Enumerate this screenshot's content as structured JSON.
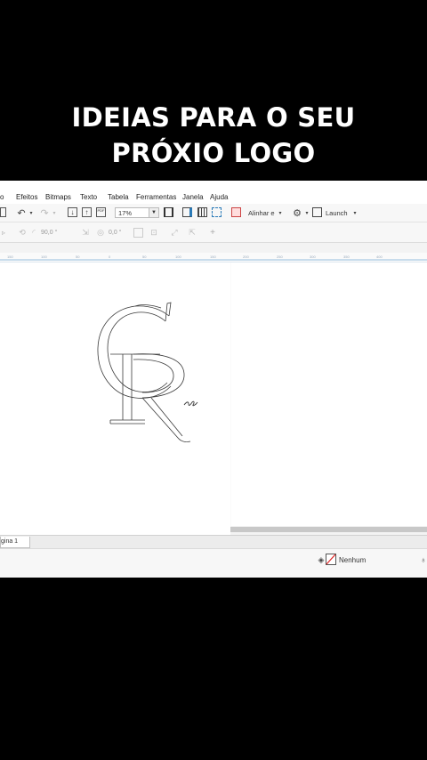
{
  "headline": {
    "line1": "IDEIAS PARA O SEU",
    "line2": "PRÓXIO LOGO"
  },
  "menu": [
    "o",
    "Efeitos",
    "Bitmaps",
    "Texto",
    "Tabela",
    "Ferramentas",
    "Janela",
    "Ajuda"
  ],
  "toolbar": {
    "zoom_value": "17%",
    "align_label": "Alinhar e",
    "launch_label": "Launch"
  },
  "property_bar": {
    "angle_value": "90,0 °",
    "rotation_value": "0,0 °"
  },
  "ruler_ticks": [
    "150",
    "100",
    "50",
    "0",
    "50",
    "100",
    "150",
    "200",
    "250",
    "300",
    "350",
    "400"
  ],
  "page_tab": "gina 1",
  "status": {
    "fill_label": "Nenhum"
  },
  "colors": {
    "background": "#000000",
    "headline_text": "#ffffff",
    "app_chrome": "#f3f3f3",
    "canvas": "#ffffff"
  }
}
